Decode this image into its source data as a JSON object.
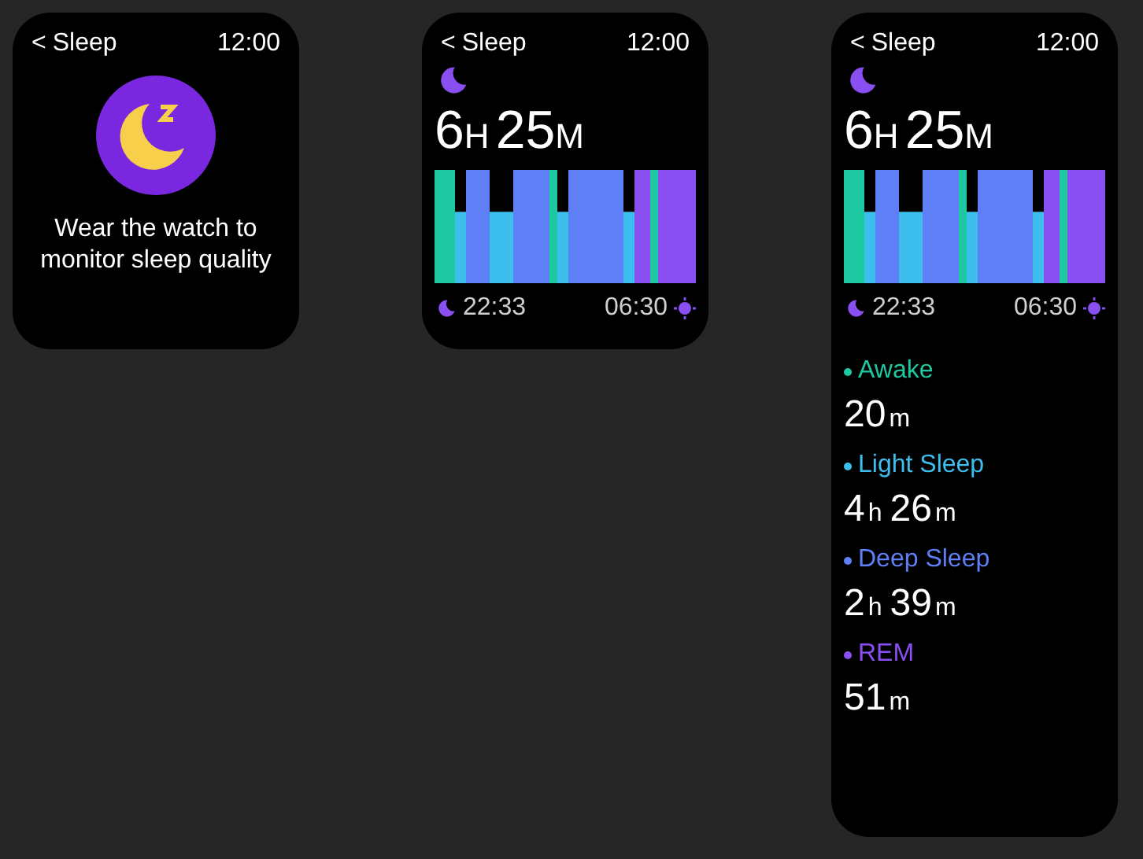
{
  "screens": [
    {
      "kind": "empty",
      "back": "<",
      "title": "Sleep",
      "time": "12:00",
      "message": "Wear the watch to monitor sleep quality"
    },
    {
      "kind": "summary",
      "back": "<",
      "title": "Sleep",
      "time": "12:00",
      "total": [
        {
          "value": "6",
          "unit": "H"
        },
        {
          "value": "25",
          "unit": "M"
        }
      ],
      "start": "22:33",
      "end": "06:30"
    },
    {
      "kind": "detail",
      "back": "<",
      "title": "Sleep",
      "time": "12:00",
      "total": [
        {
          "value": "6",
          "unit": "H"
        },
        {
          "value": "25",
          "unit": "M"
        }
      ],
      "start": "22:33",
      "end": "06:30",
      "stages": [
        {
          "name": "Awake",
          "color": "#1ec9a2",
          "duration": [
            {
              "value": "20",
              "unit": "m"
            }
          ]
        },
        {
          "name": "Light Sleep",
          "color": "#3dbfee",
          "duration": [
            {
              "value": "4",
              "unit": "h"
            },
            {
              "value": "26",
              "unit": "m"
            }
          ]
        },
        {
          "name": "Deep Sleep",
          "color": "#5f7ff6",
          "duration": [
            {
              "value": "2",
              "unit": "h"
            },
            {
              "value": "39",
              "unit": "m"
            }
          ]
        },
        {
          "name": "REM",
          "color": "#8a4ff0",
          "duration": [
            {
              "value": "51",
              "unit": "m"
            }
          ]
        }
      ]
    }
  ]
}
